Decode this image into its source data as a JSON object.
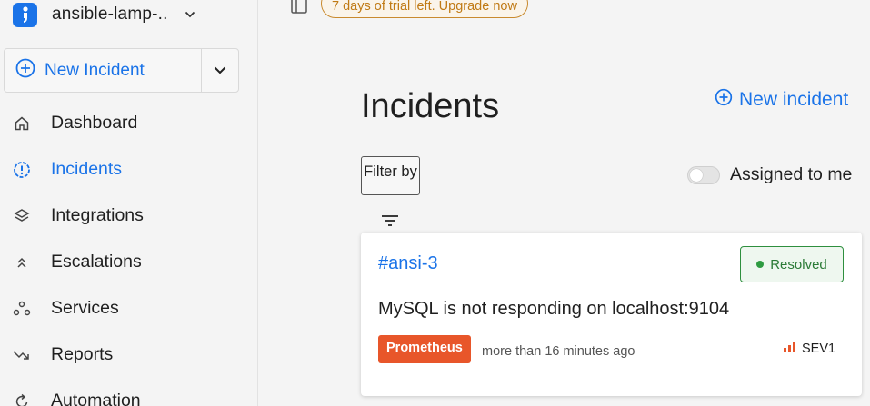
{
  "sidebar": {
    "workspace_name": "ansible-lamp-..",
    "new_incident_label": "New Incident",
    "items": [
      {
        "label": "Dashboard",
        "icon": "home-icon",
        "active": false
      },
      {
        "label": "Incidents",
        "icon": "alert-circle-icon",
        "active": true
      },
      {
        "label": "Integrations",
        "icon": "layers-icon",
        "active": false
      },
      {
        "label": "Escalations",
        "icon": "double-chevron-up-icon",
        "active": false
      },
      {
        "label": "Services",
        "icon": "services-icon",
        "active": false
      },
      {
        "label": "Reports",
        "icon": "trend-down-icon",
        "active": false
      },
      {
        "label": "Automation",
        "icon": "refresh-icon",
        "active": false
      }
    ]
  },
  "banner": {
    "trial_text": "7 days of trial left. Upgrade now"
  },
  "main": {
    "title": "Incidents",
    "new_incident_link": "New incident",
    "filter_label": "Filter by",
    "assigned_label": "Assigned to me",
    "assigned_toggle": false
  },
  "incident": {
    "id": "#ansi-3",
    "status": "Resolved",
    "title": "MySQL is not responding on localhost:9104",
    "source": "Prometheus",
    "time": "more than 16 minutes ago",
    "severity": "SEV1"
  },
  "colors": {
    "accent": "#1a73e8",
    "trial": "#c07a15",
    "resolved": "#2e8f3e",
    "source_tag": "#e8562a",
    "severity": "#e8562a"
  }
}
